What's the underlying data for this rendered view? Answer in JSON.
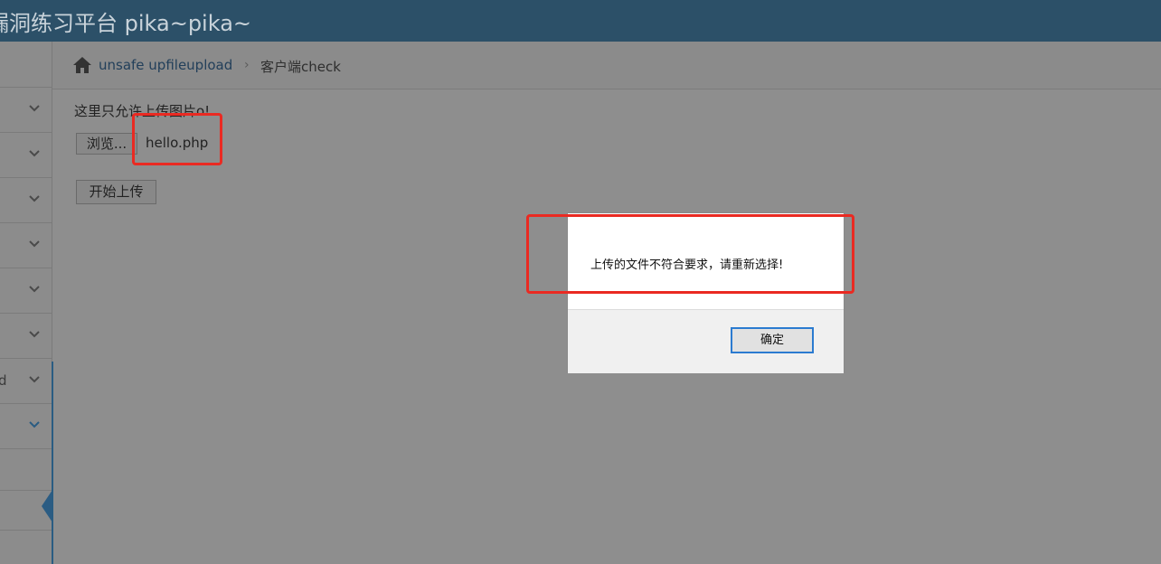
{
  "header": {
    "title": "漏洞练习平台 pika~pika~"
  },
  "sidebar": {
    "items": [
      {
        "label": ""
      },
      {
        "label": ""
      },
      {
        "label": ""
      },
      {
        "label": ""
      },
      {
        "label": ""
      },
      {
        "label": ""
      },
      {
        "label": "d"
      },
      {
        "label": ""
      }
    ]
  },
  "breadcrumb": {
    "parent": "unsafe upfileupload",
    "separator": "›",
    "current": "客户端check"
  },
  "main": {
    "hint": "这里只允许上传图片o!",
    "browse_label": "浏览...",
    "filename": "hello.php",
    "upload_label": "开始上传"
  },
  "dialog": {
    "message": "上传的文件不符合要求，请重新选择!",
    "ok_label": "确定"
  },
  "colors": {
    "header_bg": "#2c5068",
    "annotation_red": "#ea2a22",
    "accent_blue": "#2b7bd0"
  }
}
